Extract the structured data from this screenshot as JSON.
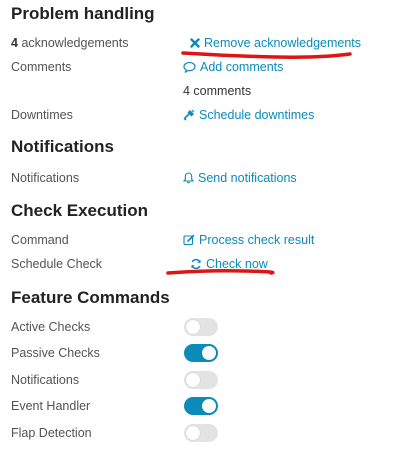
{
  "colors": {
    "accent": "#0a8bb8",
    "annotation": "#dd1515",
    "toggle_off": "#e3e3e3"
  },
  "problem_handling": {
    "heading": "Problem handling",
    "ack_count": "4",
    "ack_label": "acknowledgements",
    "remove_ack": "Remove acknowledgements",
    "comments_label": "Comments",
    "add_comments": "Add comments",
    "comments_count": "4 comments",
    "downtimes_label": "Downtimes",
    "schedule_downtimes": "Schedule downtimes"
  },
  "notifications": {
    "heading": "Notifications",
    "label": "Notifications",
    "send": "Send notifications"
  },
  "check_execution": {
    "heading": "Check Execution",
    "command_label": "Command",
    "process_result": "Process check result",
    "schedule_label": "Schedule Check",
    "check_now": "Check now"
  },
  "feature_commands": {
    "heading": "Feature Commands",
    "items": [
      {
        "label": "Active Checks",
        "enabled": false
      },
      {
        "label": "Passive Checks",
        "enabled": true
      },
      {
        "label": "Notifications",
        "enabled": false
      },
      {
        "label": "Event Handler",
        "enabled": true
      },
      {
        "label": "Flap Detection",
        "enabled": false
      }
    ]
  }
}
